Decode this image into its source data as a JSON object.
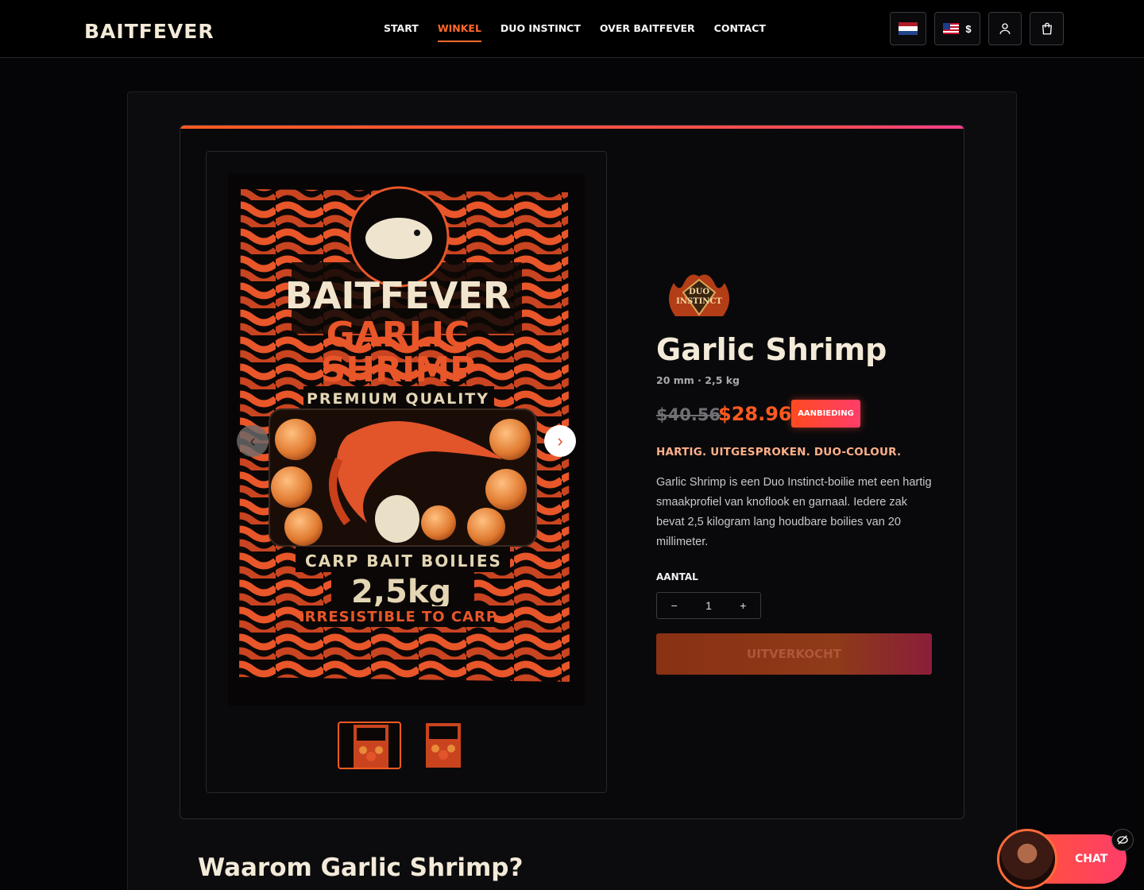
{
  "header": {
    "logo": "BAITFEVER",
    "nav": [
      "START",
      "WINKEL",
      "DUO INSTINCT",
      "OVER BAITFEVER",
      "CONTACT"
    ],
    "active_nav": "WINKEL",
    "currency": "$"
  },
  "product": {
    "badge_logo_text": "DUO INSTINCT",
    "title": "Garlic Shrimp",
    "subtitle": "20 mm · 2,5 kg",
    "old_price": "$40.56",
    "new_price": "$28.96",
    "sale_badge": "AANBIEDING",
    "tagline": "HARTIG. UITGESPROKEN. DUO-COLOUR.",
    "description": "Garlic Shrimp is een Duo Instinct-boilie met een hartig smaakprofiel van knoflook en garnaal. Iedere zak bevat 2,5 kilogram lang houdbare boilies van 20 millimeter.",
    "quantity_label": "AANTAL",
    "quantity_value": "1",
    "minus": "−",
    "plus": "+",
    "buy_label": "UITVERKOCHT",
    "pack": {
      "brand": "BAITFEVER",
      "line1": "GARLIC",
      "line2": "SHRIMP",
      "quality": "PREMIUM QUALITY",
      "type": "CARP BAIT BOILIES",
      "weight": "2,5kg",
      "claim": "IRRESISTIBLE TO CARP"
    }
  },
  "section_heading": "Waarom Garlic Shrimp?",
  "chat": {
    "label": "CHAT"
  },
  "colors": {
    "accent": "#ff5a1f",
    "pink": "#ff3d8f",
    "cream": "#f3ead8"
  }
}
